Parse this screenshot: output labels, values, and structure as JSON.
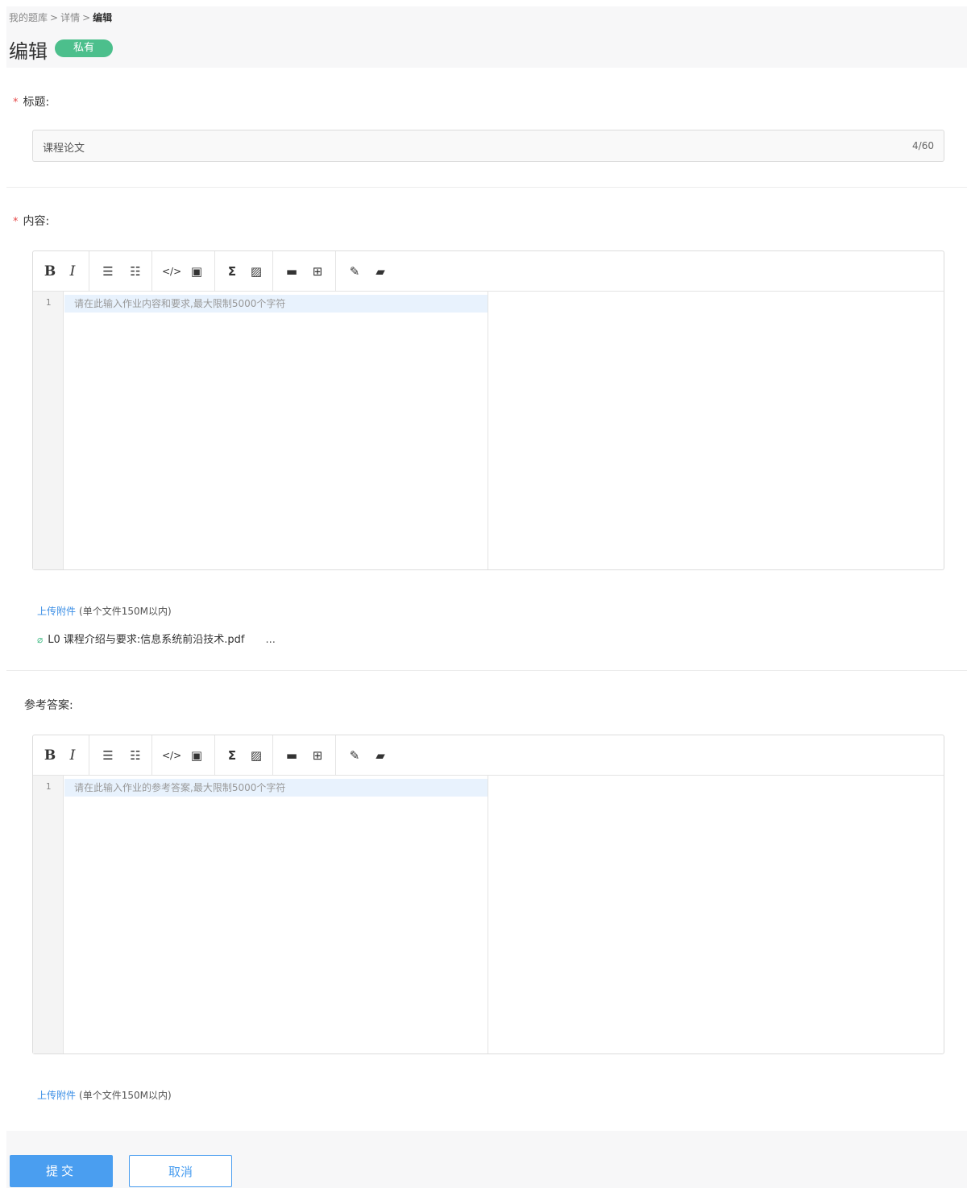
{
  "breadcrumb": {
    "item1": "我的题库",
    "item2": "详情",
    "current": "编辑",
    "sep": ">"
  },
  "header": {
    "title": "编辑",
    "badge": "私有"
  },
  "title_field": {
    "label": "标题:",
    "value": "课程论文",
    "counter": "4/60"
  },
  "content_field": {
    "label": "内容:",
    "line_number": "1",
    "placeholder": "请在此输入作业内容和要求,最大限制5000个字符"
  },
  "answer_field": {
    "label": "参考答案:",
    "line_number": "1",
    "placeholder": "请在此输入作业的参考答案,最大限制5000个字符"
  },
  "upload": {
    "link": "上传附件",
    "hint": "(单个文件150M以内)"
  },
  "attachment": {
    "filename": "L0 课程介绍与要求:信息系统前沿技术.pdf",
    "more": "..."
  },
  "toolbar_icons": {
    "bold": "B",
    "italic": "I",
    "ul": "☰",
    "ol": "☷",
    "code": "</>",
    "code_block": "▣",
    "formula": "Σ",
    "formula_block": "▨",
    "image": "▬",
    "table": "⊞",
    "preview": "✎",
    "clear": "▰"
  },
  "buttons": {
    "submit": "提交",
    "cancel": "取消"
  },
  "colors": {
    "accent": "#4a9ef0",
    "badge": "#4cbf8c",
    "required": "#e64b4b",
    "link": "#3a8ee6"
  }
}
